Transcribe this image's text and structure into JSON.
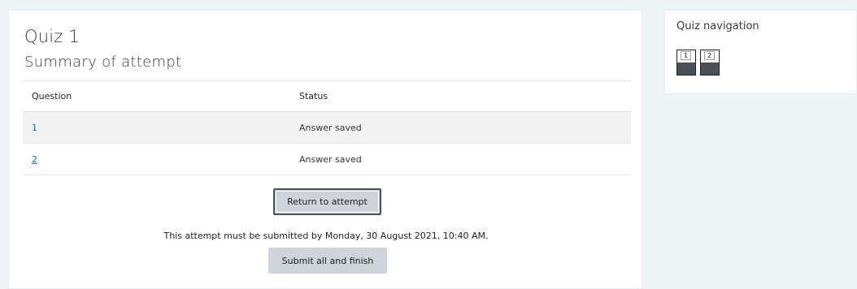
{
  "quiz": {
    "title": "Quiz 1",
    "summary_heading": "Summary of attempt"
  },
  "table": {
    "headers": {
      "question": "Question",
      "status": "Status"
    },
    "rows": [
      {
        "question": "1",
        "status": "Answer saved"
      },
      {
        "question": "2",
        "status": "Answer saved"
      }
    ]
  },
  "actions": {
    "return_label": "Return to attempt",
    "deadline_text": "This attempt must be submitted by Monday, 30 August 2021, 10:40 AM.",
    "submit_label": "Submit all and finish"
  },
  "navigation": {
    "title": "Quiz navigation",
    "buttons": [
      {
        "label": "1",
        "state": "answered"
      },
      {
        "label": "2",
        "state": "answered"
      }
    ]
  },
  "colors": {
    "link": "#0f6cbf",
    "button_bg": "#ced4da",
    "answered_state": "#495057",
    "page_bg": "#eef3f6"
  }
}
